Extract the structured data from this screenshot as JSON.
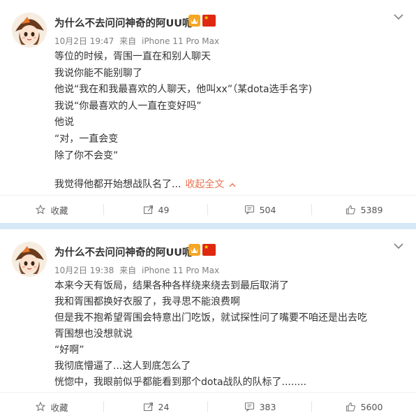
{
  "posts": [
    {
      "username": "为什么不去问问神奇的阿UU呢",
      "date": "10月2日 19:47",
      "source_prefix": "来自",
      "device": "iPhone 11 Pro Max",
      "lines": [
        "等位的时候，胥围一直在和别人聊天",
        "我说你能不能别聊了",
        "他说“我在和我最喜欢的人聊天，他叫xx”（某dota选手名字)",
        "我说“你最喜欢的人一直在变好吗”",
        "他说",
        "“对，一直会变",
        "除了你不会变”",
        "",
        "我觉得他都开始想战队名了..."
      ],
      "collapse_label": "收起全文",
      "actions": {
        "favorite": "收藏",
        "repost": "49",
        "comment": "504",
        "like": "5389"
      }
    },
    {
      "username": "为什么不去问问神奇的阿UU呢",
      "date": "10月2日 19:38",
      "source_prefix": "来自",
      "device": "iPhone 11 Pro Max",
      "lines": [
        "本来今天有饭局，结果各种各样绕来绕去到最后取消了",
        "我和胥围都换好衣服了，我寻思不能浪费啊",
        "但是我不抱希望胥围会特意出门吃饭，就试探性问了嘴要不咱还是出去吃",
        "胥围想也没想就说",
        "“好啊”",
        "我彻底懵逼了...这人到底怎么了",
        "恍惚中，我眼前似乎都能看到那个dota战队的队标了........"
      ],
      "actions": {
        "favorite": "收藏",
        "repost": "24",
        "comment": "383",
        "like": "5600"
      }
    }
  ],
  "colors": {
    "accent": "#eb7350",
    "divider": "#d6e8f5",
    "meta": "#808080",
    "vip": "#f5a623",
    "flag": "#de2910"
  },
  "icons": [
    "avatar",
    "vip-badge-icon",
    "china-flag-icon",
    "chevron-down-icon",
    "star-icon",
    "repost-icon",
    "comment-icon",
    "like-icon",
    "chevron-up-icon"
  ]
}
